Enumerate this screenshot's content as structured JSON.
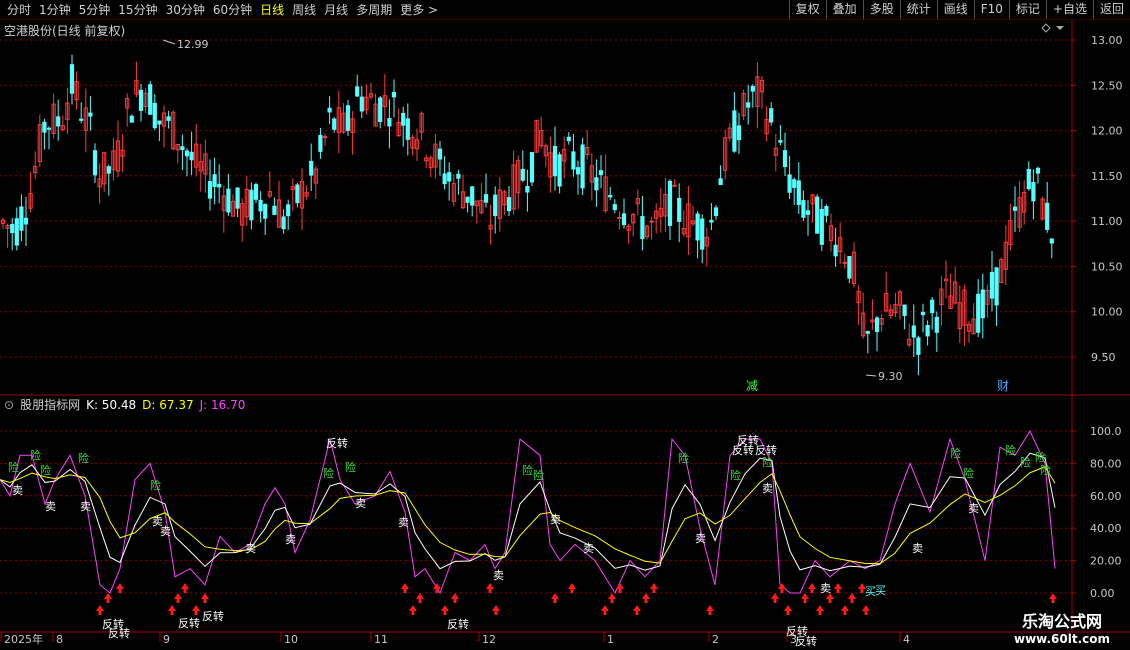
{
  "toolbar": {
    "periods": [
      "分时",
      "1分钟",
      "5分钟",
      "15分钟",
      "30分钟",
      "60分钟",
      "日线",
      "周线",
      "月线",
      "多周期",
      "更多 >"
    ],
    "active_period": "日线",
    "actions": [
      "复权",
      "叠加",
      "多股",
      "统计",
      "画线",
      "F10",
      "标记",
      "+自选",
      "返回"
    ]
  },
  "main_panel": {
    "title": "空港股份(日线 前复权)",
    "high_label": "12.99",
    "low_label": "9.30",
    "y_ticks": [
      "13.00",
      "12.50",
      "12.00",
      "11.50",
      "11.00",
      "10.50",
      "10.00",
      "9.50"
    ],
    "markers": [
      "减",
      "财"
    ]
  },
  "indicator_panel": {
    "name": "股朋指标网",
    "k": "K: 50.48",
    "d": "D: 67.37",
    "j": "J: 16.70",
    "y_ticks": [
      "100.0",
      "80.00",
      "60.00",
      "40.00",
      "20.00",
      "0.00"
    ]
  },
  "x_axis": {
    "labels": [
      "2025年",
      "8",
      "9",
      "10",
      "11",
      "12",
      "1",
      "2",
      "3",
      "4"
    ]
  },
  "signals": {
    "risk": "险",
    "sell": "卖",
    "reverse": "反转",
    "buy": "买"
  },
  "watermark": {
    "line1": "乐淘公式网",
    "line2": "www.60lt.com"
  },
  "colors": {
    "up": "#ff3b3b",
    "down": "#54ffff",
    "k": "#ffffff",
    "d": "#ffff00",
    "j": "#ff40ff",
    "grid": "#8b0000"
  },
  "chart_data": {
    "type": "candlestick",
    "symbol": "空港股份",
    "price_max": 12.99,
    "price_min": 9.3,
    "ylim": [
      9.2,
      13.1
    ],
    "kdj_latest": {
      "K": 50.48,
      "D": 67.37,
      "J": 16.7
    }
  }
}
